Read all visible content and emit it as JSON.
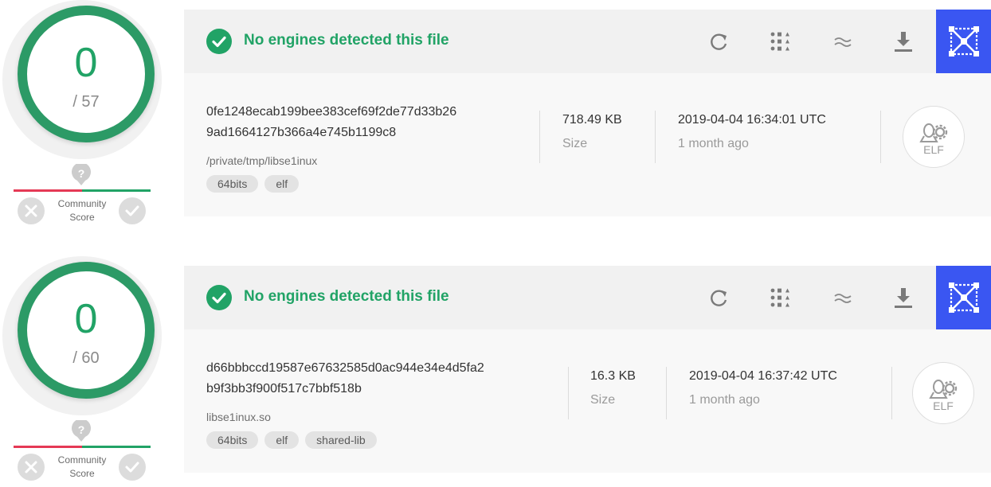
{
  "reports": [
    {
      "score": {
        "detections": "0",
        "total": "/ 57"
      },
      "community": {
        "label_line1": "Community",
        "label_line2": "Score",
        "icon": "question-icon"
      },
      "status": "No engines detected this file",
      "actions": [
        "reanalyze-icon",
        "similar-icon",
        "compare-icon",
        "download-icon",
        "graph-icon"
      ],
      "hash_line1": "0fe1248ecab199bee383cef69f2de77d33b26",
      "hash_line2": "9ad1664127b366a4e745b1199c8",
      "filename": "/private/tmp/libse1inux",
      "tags": [
        "64bits",
        "elf"
      ],
      "size": {
        "value": "718.49 KB",
        "label": "Size"
      },
      "date": {
        "value": "2019-04-04 16:34:01 UTC",
        "relative": "1 month ago"
      },
      "file_type": "ELF"
    },
    {
      "score": {
        "detections": "0",
        "total": "/ 60"
      },
      "community": {
        "label_line1": "Community",
        "label_line2": "Score",
        "icon": "question-icon"
      },
      "status": "No engines detected this file",
      "actions": [
        "reanalyze-icon",
        "similar-icon",
        "compare-icon",
        "download-icon",
        "graph-icon"
      ],
      "hash_line1": "d66bbbccd19587e67632585d0ac944e34e4d5fa2",
      "hash_line2": "b9f3bb3f900f517c7bbf518b",
      "filename": "libse1inux.so",
      "tags": [
        "64bits",
        "elf",
        "shared-lib"
      ],
      "size": {
        "value": "16.3 KB",
        "label": "Size"
      },
      "date": {
        "value": "2019-04-04 16:37:42 UTC",
        "relative": "1 month ago"
      },
      "file_type": "ELF"
    }
  ],
  "colors": {
    "accent_green": "#21a366",
    "ring_green": "#2c9a66",
    "accent_red": "#e53955",
    "accent_blue": "#3a56f2"
  }
}
